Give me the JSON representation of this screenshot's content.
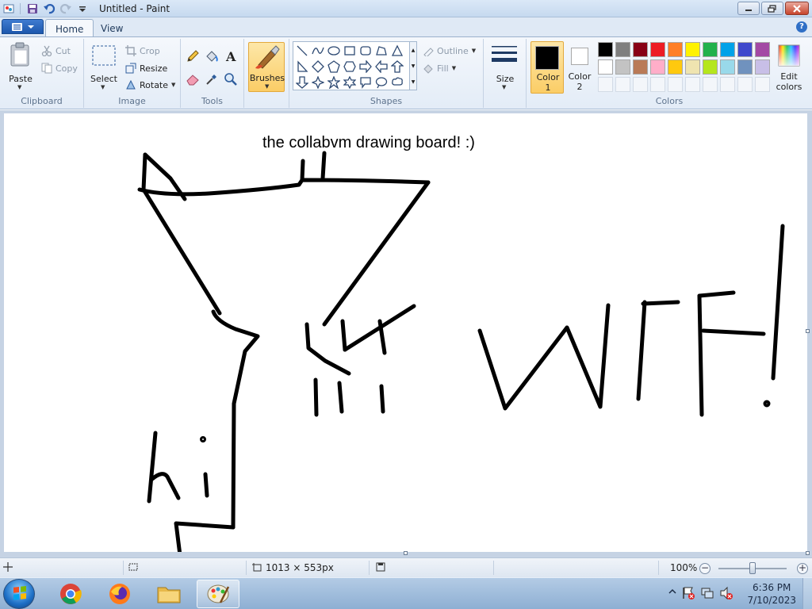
{
  "window": {
    "title": "Untitled - Paint"
  },
  "tabs": {
    "home": "Home",
    "view": "View"
  },
  "clipboard": {
    "paste": "Paste",
    "cut": "Cut",
    "copy": "Copy",
    "group": "Clipboard"
  },
  "image": {
    "select": "Select",
    "crop": "Crop",
    "resize": "Resize",
    "rotate": "Rotate",
    "group": "Image"
  },
  "tools": {
    "group": "Tools"
  },
  "brushes": {
    "label": "Brushes"
  },
  "shapes": {
    "outline": "Outline",
    "fill": "Fill",
    "group": "Shapes"
  },
  "size": {
    "label": "Size"
  },
  "colors": {
    "color1_label": "Color",
    "color1_num": "1",
    "color2_label": "Color",
    "color2_num": "2",
    "edit_label": "Edit",
    "edit_label2": "colors",
    "group": "Colors",
    "color1": "#000000",
    "color2": "#ffffff",
    "palette_row1": [
      "#000000",
      "#7f7f7f",
      "#880015",
      "#ed1c24",
      "#ff7f27",
      "#fff200",
      "#22b14c",
      "#00a2e8",
      "#3f48cc",
      "#a349a4"
    ],
    "palette_row2": [
      "#ffffff",
      "#c3c3c3",
      "#b97a57",
      "#ffaec9",
      "#ffc90e",
      "#efe4b0",
      "#b5e61d",
      "#99d9ea",
      "#7092be",
      "#c8bfe7"
    ]
  },
  "canvas": {
    "text": "the collabvm drawing board! :)",
    "wtf": "WTF!",
    "hi": "hi"
  },
  "status": {
    "dimensions": "1013 × 553px",
    "zoom": "100%"
  },
  "taskbar": {
    "time": "6:36 PM",
    "date": "7/10/2023"
  }
}
